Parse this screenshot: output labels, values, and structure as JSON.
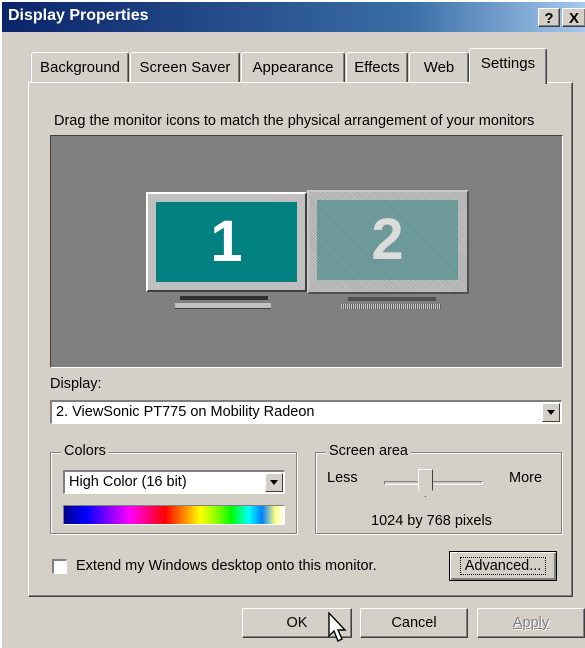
{
  "window": {
    "title": "Display Properties",
    "help_label": "?",
    "close_label": "X"
  },
  "tabs": [
    {
      "label": "Background",
      "active": false
    },
    {
      "label": "Screen Saver",
      "active": false
    },
    {
      "label": "Appearance",
      "active": false
    },
    {
      "label": "Effects",
      "active": false
    },
    {
      "label": "Web",
      "active": false
    },
    {
      "label": "Settings",
      "active": true
    }
  ],
  "settings": {
    "instruction": "Drag the monitor icons to match the physical arrangement of your monitors",
    "monitors": [
      {
        "number": "1",
        "selected": false,
        "screen_color": "#008080"
      },
      {
        "number": "2",
        "selected": true,
        "screen_color": "#5f8f8f"
      }
    ],
    "display_label": "Display:",
    "display_value": "2. ViewSonic PT775 on Mobility Radeon",
    "colors": {
      "group_label": "Colors",
      "selected_value": "High Color (16 bit)"
    },
    "screen_area": {
      "group_label": "Screen area",
      "less_label": "Less",
      "more_label": "More",
      "resolution_text": "1024 by 768 pixels",
      "slider_position": 0.35
    },
    "extend_desktop": {
      "label": "Extend my Windows desktop onto this monitor.",
      "checked": false
    },
    "advanced_label": "Advanced..."
  },
  "buttons": {
    "ok_label": "OK",
    "cancel_label": "Cancel",
    "apply_label": "Apply"
  },
  "colors": {
    "title_bar": "#0a246a",
    "face": "#d4d0c8",
    "monitor_area": "#808080"
  }
}
